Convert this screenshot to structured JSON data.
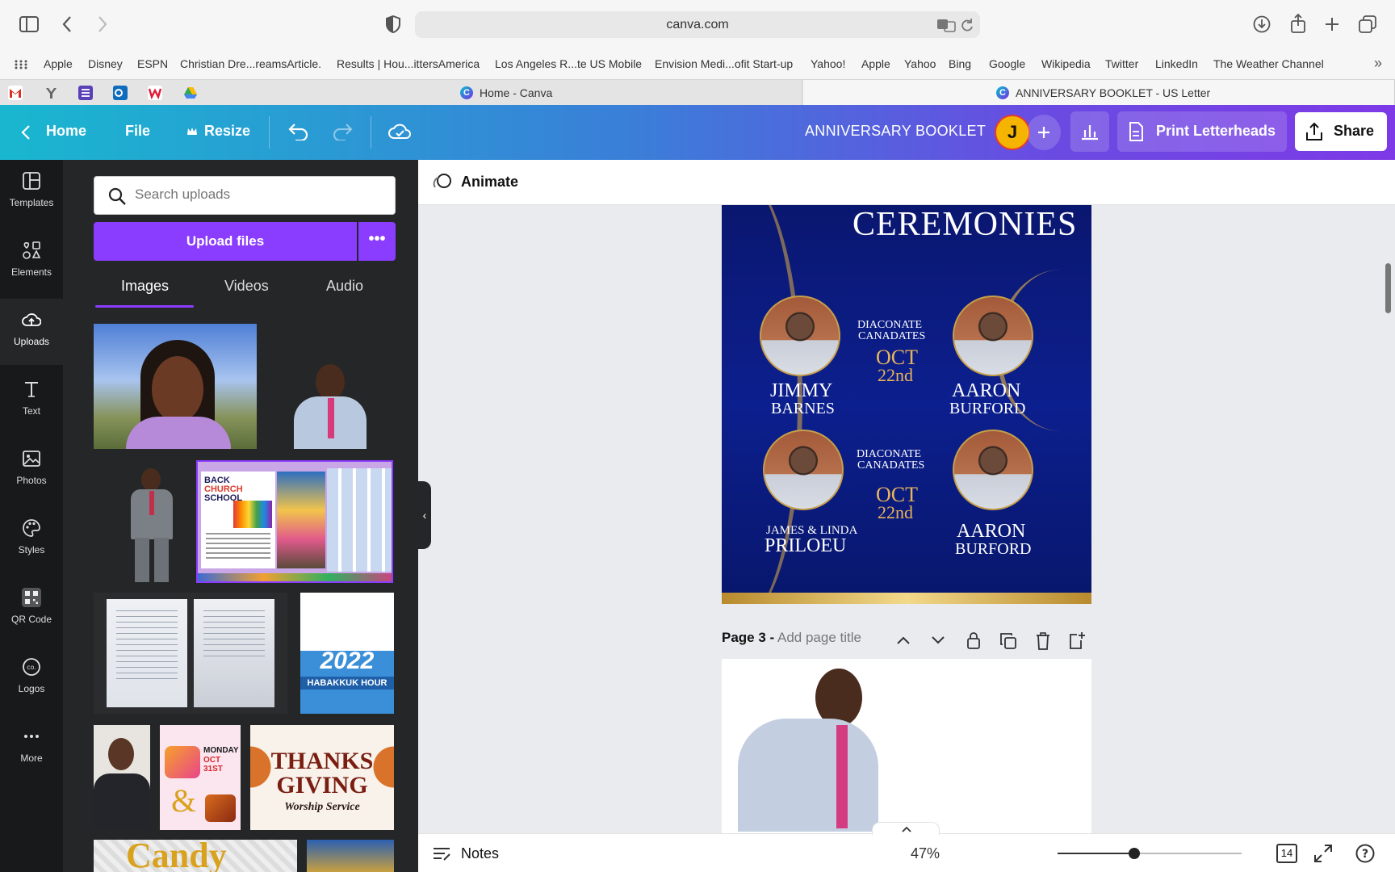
{
  "browser": {
    "url": "canva.com",
    "bookmarks": [
      "Apple",
      "Disney",
      "ESPN",
      "Christian Dre...reamsArticle.",
      "Results | Hou...ittersAmerica",
      "Los Angeles R...te US Mobile",
      "Envision Medi...ofit Start-up",
      "Yahoo!",
      "Apple",
      "Yahoo",
      "Bing",
      "Google",
      "Wikipedia",
      "Twitter",
      "LinkedIn",
      "The Weather Channel"
    ],
    "tabs": [
      "Home - Canva",
      "ANNIVERSARY BOOKLET - US Letter"
    ]
  },
  "header": {
    "home": "Home",
    "file": "File",
    "resize": "Resize",
    "doc_title": "ANNIVERSARY BOOKLET",
    "avatar": "J",
    "print": "Print Letterheads",
    "share": "Share"
  },
  "rail": [
    "Templates",
    "Elements",
    "Uploads",
    "Text",
    "Photos",
    "Styles",
    "QR Code",
    "Logos",
    "More"
  ],
  "panel": {
    "search_placeholder": "Search uploads",
    "upload": "Upload files",
    "tabs": [
      "Images",
      "Videos",
      "Audio"
    ],
    "thumb_text": {
      "back": "BACK",
      "church": "CHURCH",
      "school": "SCHOOL",
      "year": "2022",
      "habakkuk": "HABAKKUK HOUR",
      "candy_monday": "MONDAY",
      "candy_date": "OCT 31ST",
      "thanks": "THANKS",
      "giving": "GIVING",
      "worship": "Worship Service",
      "candy": "Candy"
    }
  },
  "editor": {
    "animate": "Animate",
    "page3_prefix": "Page 3 -",
    "page3_placeholder": "Add page title",
    "notes": "Notes",
    "zoom": "47%",
    "page_count": "14"
  },
  "design": {
    "heading": "CEREMONIES",
    "people": [
      {
        "first": "JIMMY",
        "last": "BARNES"
      },
      {
        "first": "AARON",
        "last": "BURFORD"
      },
      {
        "first": "JAMES & LINDA",
        "last": "PRILOEU"
      },
      {
        "first": "AARON",
        "last": "BURFORD"
      }
    ],
    "block": {
      "line1": "DIACONATE",
      "line2": "CANADATES",
      "month": "OCT",
      "day": "22nd"
    }
  }
}
